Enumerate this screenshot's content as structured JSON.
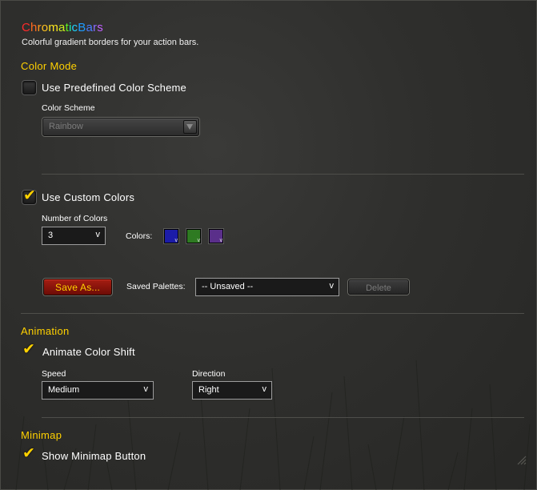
{
  "header": {
    "title_letters": [
      "C",
      "h",
      "r",
      "o",
      "m",
      "a",
      "t",
      "i",
      "c",
      "B",
      "a",
      "r",
      "s"
    ],
    "title_colors": [
      "#ff2a2a",
      "#ff6a1e",
      "#ff9a1e",
      "#ffc21e",
      "#ffe81e",
      "#c8f01e",
      "#5ff01e",
      "#1ef0a8",
      "#1ed2ff",
      "#1e9cff",
      "#4a7dff",
      "#8a6aff",
      "#c060ff"
    ],
    "subtitle": "Colorful gradient borders for your action bars."
  },
  "color_mode": {
    "heading": "Color Mode",
    "predefined_checked": false,
    "predefined_label": "Use Predefined Color Scheme",
    "scheme_label": "Color Scheme",
    "scheme_value": "Rainbow",
    "custom_checked": true,
    "custom_label": "Use Custom Colors",
    "num_colors_label": "Number of Colors",
    "num_colors_value": "3",
    "dropdown_marker": "v",
    "colors_label": "Colors:",
    "swatches": [
      "#1c1ca8",
      "#2e7a22",
      "#5a2f8a"
    ],
    "swatch_corner": "v",
    "save_as_label": "Save As...",
    "saved_palettes_label": "Saved Palettes:",
    "saved_palettes_value": "-- Unsaved --",
    "delete_label": "Delete"
  },
  "animation": {
    "heading": "Animation",
    "animate_checked": true,
    "animate_label": "Animate Color Shift",
    "speed_label": "Speed",
    "speed_value": "Medium",
    "direction_label": "Direction",
    "direction_value": "Right"
  },
  "minimap": {
    "heading": "Minimap",
    "show_checked": true,
    "show_label": "Show Minimap Button"
  },
  "check_glyph": "✔",
  "accent_color": "#ffd100"
}
